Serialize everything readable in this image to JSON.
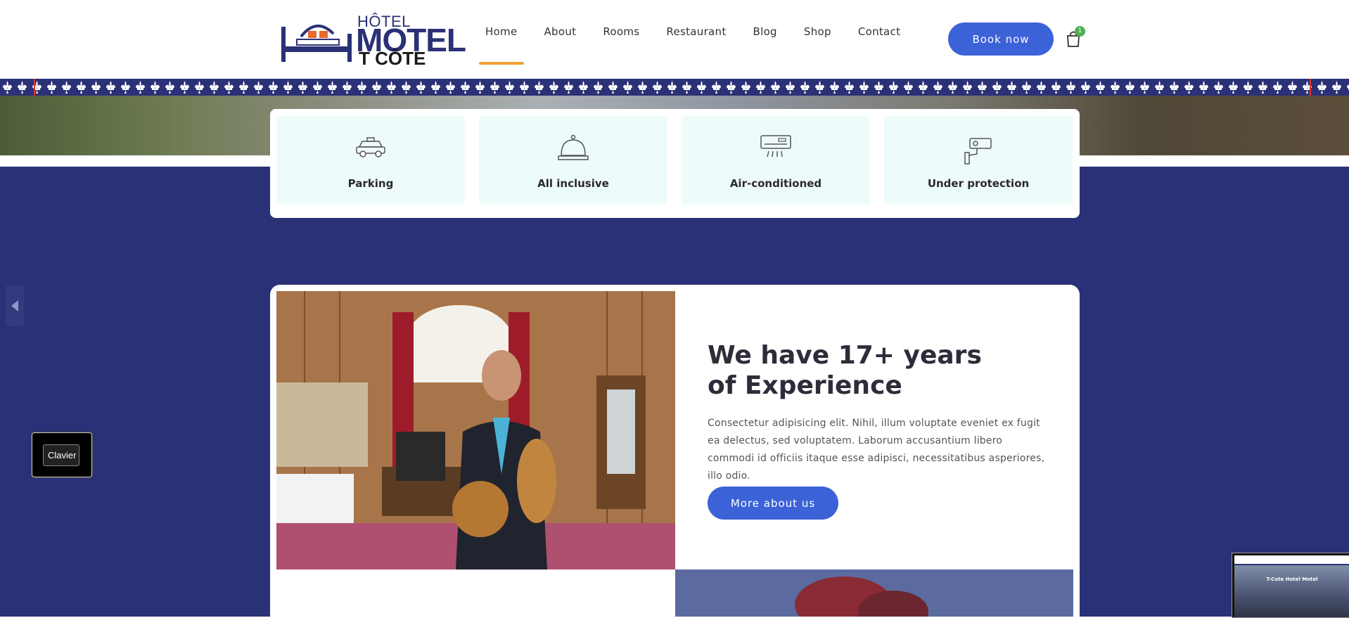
{
  "header": {
    "logo": {
      "line1": "HÔTEL",
      "line2": "MOTEL",
      "line3": "T CÔTE"
    },
    "nav": [
      {
        "label": "Home",
        "active": true
      },
      {
        "label": "About"
      },
      {
        "label": "Rooms"
      },
      {
        "label": "Restaurant"
      },
      {
        "label": "Blog"
      },
      {
        "label": "Shop"
      },
      {
        "label": "Contact"
      }
    ],
    "book_label": "Book now",
    "cart_icon": "shopping-bag-icon",
    "cart_count": "1"
  },
  "features": [
    {
      "label": "Parking",
      "icon": "car-icon"
    },
    {
      "label": "All inclusive",
      "icon": "service-bell-icon"
    },
    {
      "label": "Air-conditioned",
      "icon": "air-conditioner-icon"
    },
    {
      "label": "Under protection",
      "icon": "security-camera-icon"
    }
  ],
  "experience": {
    "title_line1": "We have 17+ years",
    "title_line2": "of Experience",
    "text": "Consectetur adipisicing elit. Nihil, illum voluptate eveniet ex fugit ea delectus, sed voluptatem. Laborum accusantium libero commodi id officiis itaque esse adipisci, necessitatibus asperiores, illo odio.",
    "button": "More about us"
  },
  "widgets": {
    "keyboard_label": "Clavier",
    "preview_title": "T-Cote Hotel Motel"
  },
  "colors": {
    "brand_navy": "#2b3176",
    "button_blue": "#3c62d8",
    "accent_orange": "#f0a132",
    "badge_green": "#4caf50"
  }
}
